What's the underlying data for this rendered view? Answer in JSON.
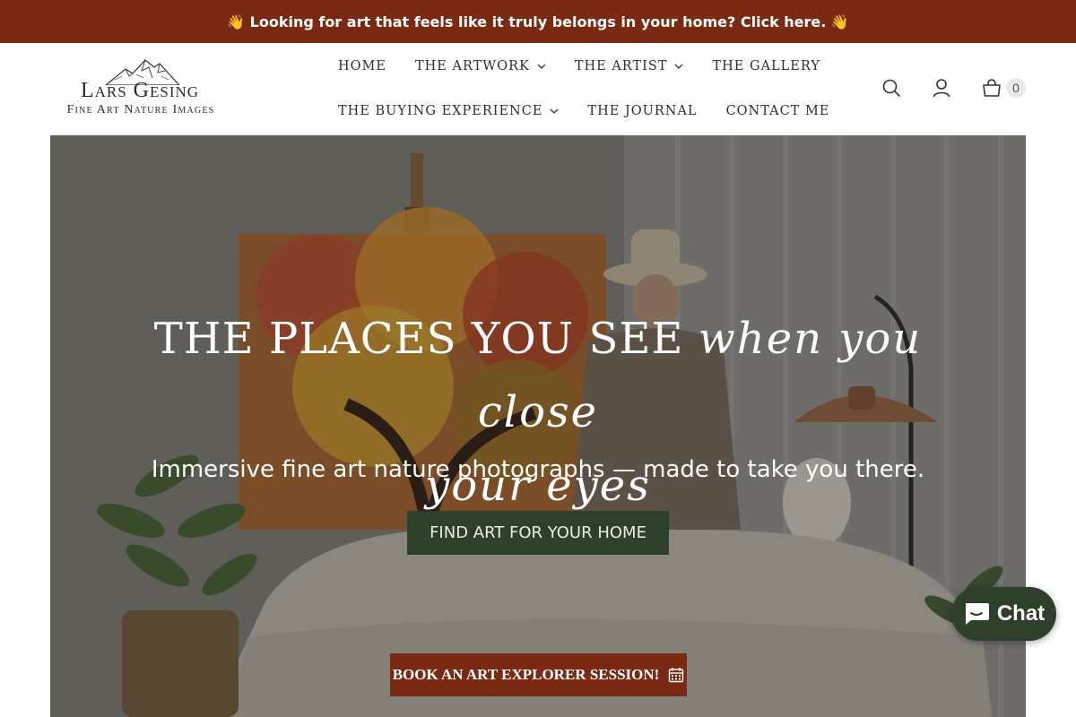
{
  "announcement": {
    "text": "👋 Looking for art that feels like it truly belongs in your home? Click here. 👋"
  },
  "logo": {
    "name": "Lars Gesing",
    "tagline": "Fine Art Nature Images"
  },
  "nav": {
    "row1": [
      {
        "label": "HOME",
        "dropdown": false
      },
      {
        "label": "THE ARTWORK",
        "dropdown": true
      },
      {
        "label": "THE ARTIST",
        "dropdown": true
      },
      {
        "label": "THE GALLERY",
        "dropdown": false
      }
    ],
    "row2": [
      {
        "label": "THE BUYING EXPERIENCE",
        "dropdown": true
      },
      {
        "label": "THE JOURNAL",
        "dropdown": false
      },
      {
        "label": "CONTACT ME",
        "dropdown": false
      }
    ]
  },
  "header_icons": {
    "search": "search-icon",
    "account": "account-icon",
    "cart": "cart-icon",
    "cart_count": "0"
  },
  "hero": {
    "title_plain": "THE PLACES YOU SEE ",
    "title_italic_1": "when you close",
    "title_italic_2": "your eyes",
    "subtitle": "Immersive fine art nature photographs — made to take you there.",
    "cta": "FIND ART FOR YOUR HOME",
    "book_label": "BOOK AN ART EXPLORER SESSION!",
    "book_icon": "calendar-icon"
  },
  "chat": {
    "label": "Chat",
    "icon": "chat-bubble-icon"
  },
  "colors": {
    "brand_rust": "#7a2a12",
    "brand_green": "#2e3f2a"
  }
}
